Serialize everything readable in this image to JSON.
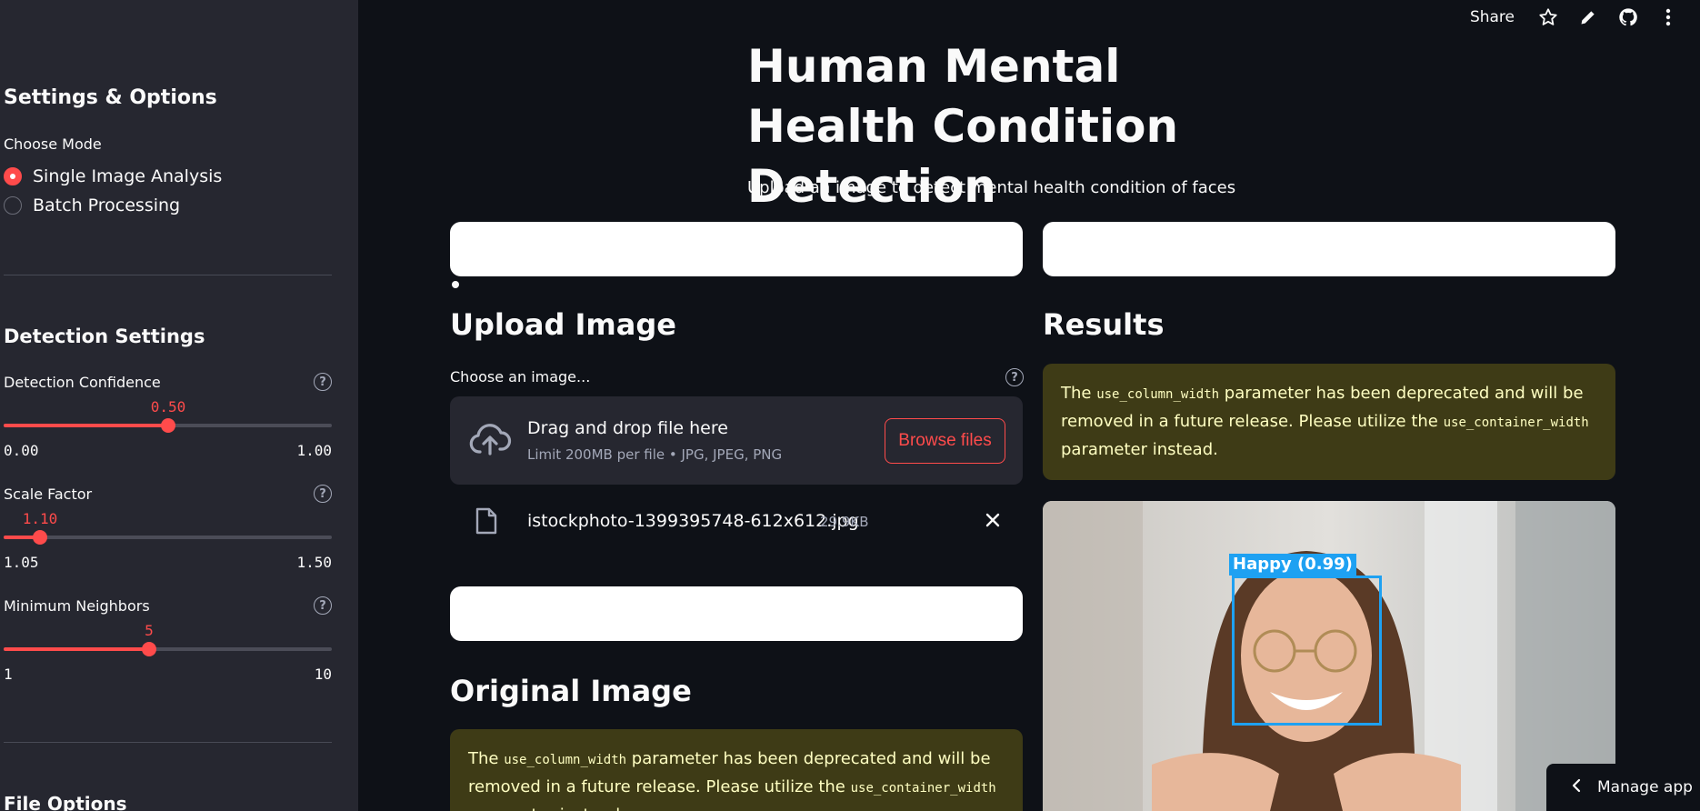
{
  "topbar": {
    "share_label": "Share"
  },
  "sidebar": {
    "settings_heading": "Settings & Options",
    "mode_label": "Choose Mode",
    "modes": [
      "Single Image Analysis",
      "Batch Processing"
    ],
    "selected_mode": "Single Image Analysis",
    "detection_heading": "Detection Settings",
    "sliders": [
      {
        "label": "Detection Confidence",
        "value": "0.50",
        "min": "0.00",
        "max": "1.00",
        "fraction": 0.5
      },
      {
        "label": "Scale Factor",
        "value": "1.10",
        "min": "1.05",
        "max": "1.50",
        "fraction": 0.1111
      },
      {
        "label": "Minimum Neighbors",
        "value": "5",
        "min": "1",
        "max": "10",
        "fraction": 0.4444
      }
    ],
    "file_heading": "File Options"
  },
  "main": {
    "title": "Human Mental Health Condition Detection",
    "subtitle": "Upload an image to detect mental health condition of faces",
    "upload_heading": "Upload Image",
    "uploader_label": "Choose an image...",
    "dropzone_title": "Drag and drop file here",
    "dropzone_limit": "Limit 200MB per file • JPG, JPEG, PNG",
    "browse_label": "Browse files",
    "uploaded_file": {
      "name": "istockphoto-1399395748-612x612.jpg",
      "size": "29.9KB"
    },
    "results_heading": "Results",
    "original_heading": "Original Image",
    "warning": {
      "pre": "The ",
      "code1": "use_column_width",
      "mid": " parameter has been deprecated and will be removed in a future release. Please utilize the ",
      "code2": "use_container_width",
      "post": " parameter instead."
    },
    "detection_label": "Happy (0.99)"
  },
  "manage_app_label": "Manage app",
  "colors": {
    "accent": "#ff4b4b",
    "sidebar_bg": "#262730",
    "main_bg": "#0e1117",
    "warning_bg": "#3e3b16",
    "detection_box": "#1ea1f2"
  }
}
